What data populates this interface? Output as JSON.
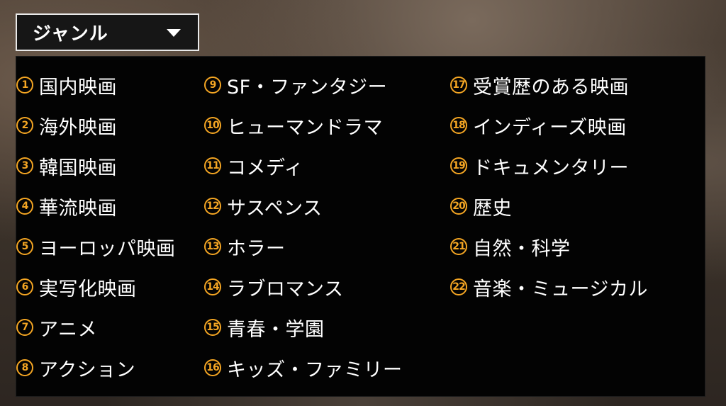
{
  "dropdown": {
    "label": "ジャンル"
  },
  "columns": [
    [
      {
        "num": "1",
        "label": "国内映画"
      },
      {
        "num": "2",
        "label": "海外映画"
      },
      {
        "num": "3",
        "label": "韓国映画"
      },
      {
        "num": "4",
        "label": "華流映画"
      },
      {
        "num": "5",
        "label": "ヨーロッパ映画"
      },
      {
        "num": "6",
        "label": "実写化映画"
      },
      {
        "num": "7",
        "label": "アニメ"
      },
      {
        "num": "8",
        "label": "アクション"
      }
    ],
    [
      {
        "num": "9",
        "label": "SF・ファンタジー"
      },
      {
        "num": "10",
        "label": "ヒューマンドラマ"
      },
      {
        "num": "11",
        "label": "コメディ"
      },
      {
        "num": "12",
        "label": "サスペンス"
      },
      {
        "num": "13",
        "label": "ホラー"
      },
      {
        "num": "14",
        "label": "ラブロマンス"
      },
      {
        "num": "15",
        "label": "青春・学園"
      },
      {
        "num": "16",
        "label": "キッズ・ファミリー"
      }
    ],
    [
      {
        "num": "17",
        "label": "受賞歴のある映画"
      },
      {
        "num": "18",
        "label": "インディーズ映画"
      },
      {
        "num": "19",
        "label": "ドキュメンタリー"
      },
      {
        "num": "20",
        "label": "歴史"
      },
      {
        "num": "21",
        "label": "自然・科学"
      },
      {
        "num": "22",
        "label": "音楽・ミュージカル"
      }
    ]
  ],
  "colors": {
    "accent": "#f5a623",
    "panel_bg": "#030303",
    "text": "#ffffff"
  },
  "icons": {
    "dropdown": "caret-down-icon"
  }
}
